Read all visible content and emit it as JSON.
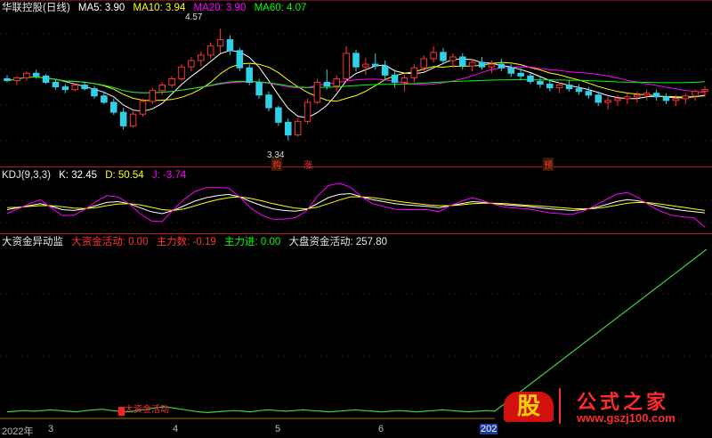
{
  "main_header": {
    "title": "华联控股(日线)",
    "ma5": "MA5: 3.90",
    "ma10": "MA10: 3.94",
    "ma20": "MA20: 3.90",
    "ma60": "MA60: 4.07"
  },
  "kdj_header": {
    "title": "KDJ(9,3,3)",
    "k": "K: 32.45",
    "d": "D: 50.54",
    "j": "J: -3.74"
  },
  "fund_header": {
    "title": "大资金异动监",
    "big_fund": "大资金活动: 0.00",
    "main_number": "主力数: -0.19",
    "main_in": "主力进: 0.00",
    "market_fund": "大盘资金活动: 257.80"
  },
  "annotations": {
    "high_price": "4.57",
    "low_price": "3.34",
    "tag_buy": "购",
    "tag_up": "涨",
    "tag_pre": "预",
    "fund_label": "大资金活动"
  },
  "x_axis": {
    "labels": [
      "2022年",
      "3",
      "4",
      "5",
      "6",
      "202"
    ]
  },
  "logo": {
    "glyph": "股",
    "text": "公式之家",
    "url": "www.gszj100.com"
  },
  "colors": {
    "up": "#ff3333",
    "down": "#30d0e8",
    "ma5": "#ffffff",
    "ma10": "#ffff00",
    "ma20": "#ff00ff",
    "ma60": "#00ff00",
    "k": "#ffffff",
    "d": "#ffff00",
    "j": "#ff00ff",
    "separator": "#b01a2a"
  },
  "chart_data": [
    {
      "type": "candlestick",
      "title": "华联控股(日线)",
      "price_range": [
        3.2,
        4.75
      ],
      "candles": [
        [
          4.02,
          4.06,
          3.98,
          4.0
        ],
        [
          4.0,
          4.05,
          3.95,
          4.03
        ],
        [
          4.03,
          4.1,
          4.0,
          4.08
        ],
        [
          4.08,
          4.12,
          4.02,
          4.05
        ],
        [
          4.05,
          4.07,
          3.96,
          3.98
        ],
        [
          3.98,
          4.02,
          3.9,
          3.93
        ],
        [
          3.93,
          3.96,
          3.86,
          3.9
        ],
        [
          3.9,
          3.97,
          3.88,
          3.95
        ],
        [
          3.95,
          3.99,
          3.89,
          3.91
        ],
        [
          3.91,
          3.94,
          3.8,
          3.83
        ],
        [
          3.83,
          3.88,
          3.74,
          3.76
        ],
        [
          3.76,
          3.8,
          3.62,
          3.65
        ],
        [
          3.65,
          3.7,
          3.46,
          3.5
        ],
        [
          3.5,
          3.66,
          3.48,
          3.63
        ],
        [
          3.63,
          3.8,
          3.6,
          3.77
        ],
        [
          3.77,
          3.92,
          3.74,
          3.89
        ],
        [
          3.89,
          3.98,
          3.84,
          3.95
        ],
        [
          3.95,
          4.05,
          3.92,
          4.02
        ],
        [
          4.02,
          4.18,
          4.0,
          4.15
        ],
        [
          4.15,
          4.26,
          4.1,
          4.22
        ],
        [
          4.22,
          4.32,
          4.16,
          4.28
        ],
        [
          4.28,
          4.42,
          4.24,
          4.38
        ],
        [
          4.38,
          4.57,
          4.3,
          4.45
        ],
        [
          4.45,
          4.5,
          4.28,
          4.33
        ],
        [
          4.33,
          4.36,
          4.1,
          4.14
        ],
        [
          4.14,
          4.18,
          3.95,
          3.98
        ],
        [
          3.98,
          4.02,
          3.8,
          3.84
        ],
        [
          3.84,
          3.88,
          3.66,
          3.7
        ],
        [
          3.7,
          3.72,
          3.5,
          3.54
        ],
        [
          3.54,
          3.58,
          3.34,
          3.4
        ],
        [
          3.4,
          3.58,
          3.38,
          3.55
        ],
        [
          3.55,
          3.8,
          3.52,
          3.76
        ],
        [
          3.76,
          4.02,
          3.74,
          3.98
        ],
        [
          3.98,
          4.12,
          3.9,
          3.94
        ],
        [
          3.94,
          4.06,
          3.88,
          4.02
        ],
        [
          4.02,
          4.38,
          4.0,
          4.3
        ],
        [
          4.3,
          4.34,
          4.1,
          4.15
        ],
        [
          4.15,
          4.25,
          4.06,
          4.18
        ],
        [
          4.18,
          4.3,
          4.12,
          4.16
        ],
        [
          4.16,
          4.22,
          4.0,
          4.06
        ],
        [
          4.06,
          4.12,
          3.92,
          3.98
        ],
        [
          3.98,
          4.06,
          3.88,
          4.03
        ],
        [
          4.03,
          4.18,
          3.98,
          4.14
        ],
        [
          4.14,
          4.28,
          4.1,
          4.24
        ],
        [
          4.24,
          4.38,
          4.2,
          4.31
        ],
        [
          4.31,
          4.36,
          4.18,
          4.22
        ],
        [
          4.22,
          4.3,
          4.14,
          4.26
        ],
        [
          4.26,
          4.3,
          4.12,
          4.16
        ],
        [
          4.16,
          4.24,
          4.1,
          4.2
        ],
        [
          4.2,
          4.26,
          4.12,
          4.15
        ],
        [
          4.15,
          4.22,
          4.08,
          4.18
        ],
        [
          4.18,
          4.24,
          4.1,
          4.14
        ],
        [
          4.14,
          4.18,
          4.04,
          4.08
        ],
        [
          4.08,
          4.14,
          4.0,
          4.05
        ],
        [
          4.05,
          4.08,
          3.96,
          3.99
        ],
        [
          3.99,
          4.04,
          3.92,
          3.96
        ],
        [
          3.96,
          4.0,
          3.88,
          3.92
        ],
        [
          3.92,
          3.98,
          3.86,
          3.95
        ],
        [
          3.95,
          4.0,
          3.88,
          3.91
        ],
        [
          3.91,
          3.96,
          3.84,
          3.88
        ],
        [
          3.88,
          3.93,
          3.8,
          3.84
        ],
        [
          3.84,
          3.88,
          3.72,
          3.76
        ],
        [
          3.76,
          3.82,
          3.68,
          3.78
        ],
        [
          3.78,
          3.84,
          3.72,
          3.8
        ],
        [
          3.8,
          3.86,
          3.74,
          3.82
        ],
        [
          3.82,
          3.88,
          3.76,
          3.84
        ],
        [
          3.84,
          3.9,
          3.78,
          3.86
        ],
        [
          3.86,
          3.9,
          3.78,
          3.82
        ],
        [
          3.82,
          3.86,
          3.74,
          3.78
        ],
        [
          3.78,
          3.84,
          3.72,
          3.8
        ],
        [
          3.8,
          3.86,
          3.74,
          3.83
        ],
        [
          3.83,
          3.9,
          3.78,
          3.88
        ],
        [
          3.88,
          3.94,
          3.82,
          3.9
        ]
      ]
    },
    {
      "type": "line",
      "title": "KDJ(9,3,3)",
      "ylim": [
        -10,
        110
      ],
      "series": [
        {
          "name": "K",
          "values": [
            40,
            45,
            50,
            55,
            48,
            40,
            38,
            42,
            50,
            58,
            60,
            55,
            45,
            35,
            30,
            38,
            50,
            62,
            70,
            75,
            78,
            72,
            60,
            50,
            42,
            38,
            36,
            40,
            55,
            70,
            78,
            80,
            72,
            65,
            60,
            55,
            52,
            50,
            48,
            45,
            50,
            55,
            60,
            58,
            55,
            52,
            50,
            48,
            45,
            42,
            40,
            38,
            40,
            45,
            52,
            60,
            65,
            62,
            55,
            48,
            42,
            38,
            35,
            32
          ]
        },
        {
          "name": "D",
          "values": [
            45,
            46,
            48,
            50,
            50,
            47,
            44,
            43,
            45,
            50,
            54,
            55,
            52,
            46,
            40,
            38,
            42,
            50,
            58,
            65,
            70,
            72,
            68,
            62,
            55,
            49,
            44,
            42,
            46,
            55,
            64,
            72,
            72,
            70,
            66,
            62,
            58,
            55,
            52,
            50,
            50,
            52,
            55,
            56,
            56,
            55,
            53,
            51,
            49,
            47,
            45,
            43,
            42,
            43,
            46,
            51,
            56,
            58,
            57,
            54,
            50,
            46,
            42,
            38
          ]
        },
        {
          "name": "J",
          "values": [
            30,
            42,
            55,
            65,
            44,
            25,
            26,
            40,
            60,
            75,
            72,
            55,
            30,
            12,
            10,
            40,
            66,
            86,
            95,
            95,
            94,
            72,
            44,
            26,
            16,
            16,
            20,
            36,
            73,
            100,
            106,
            96,
            72,
            55,
            48,
            41,
            40,
            40,
            40,
            35,
            50,
            61,
            70,
            62,
            53,
            46,
            44,
            42,
            37,
            32,
            30,
            28,
            36,
            49,
            64,
            78,
            83,
            70,
            51,
            36,
            26,
            22,
            20,
            -4
          ]
        }
      ]
    },
    {
      "type": "line",
      "title": "大资金异动监",
      "series": [
        {
          "name": "大盘资金活动",
          "values": [
            10,
            11,
            12,
            11,
            12,
            13,
            12,
            11,
            10,
            12,
            13,
            14,
            12,
            11,
            10,
            12,
            14,
            16,
            18,
            16,
            14,
            12,
            10,
            9,
            10,
            11,
            12,
            11,
            10,
            12,
            13,
            12,
            11,
            12,
            13,
            12,
            11,
            10,
            11,
            12,
            13,
            12,
            11,
            10,
            11,
            12,
            11,
            10,
            11,
            12,
            13,
            12,
            11,
            10,
            11,
            12,
            11,
            257.8
          ]
        }
      ]
    }
  ]
}
